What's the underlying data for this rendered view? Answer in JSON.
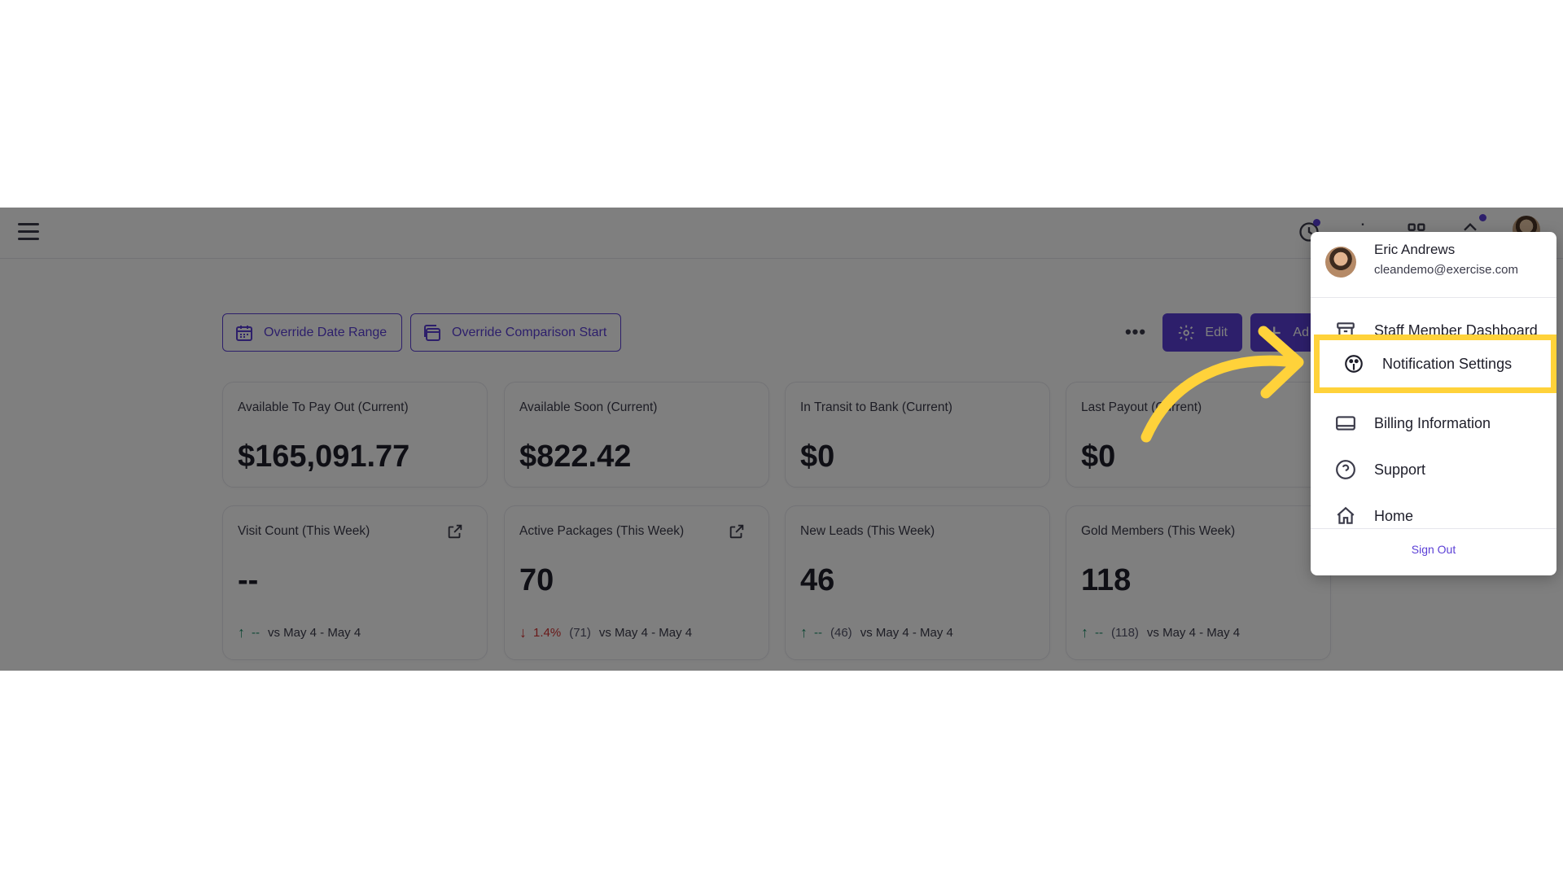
{
  "toolbar": {
    "override_date_range": "Override Date Range",
    "override_comparison_start": "Override Comparison Start",
    "more": "•••",
    "edit": "Edit",
    "add": "Ad"
  },
  "cards": [
    {
      "label": "Available To Pay Out (Current)",
      "value": "$165,091.77"
    },
    {
      "label": "Available Soon (Current)",
      "value": "$822.42"
    },
    {
      "label": "In Transit to Bank (Current)",
      "value": "$0"
    },
    {
      "label": "Last Payout (Current)",
      "value": "$0"
    },
    {
      "label": "Visit Count (This Week)",
      "value": "--",
      "trend": "up",
      "pct": "--",
      "prev": "",
      "range": "vs May 4 - May 4"
    },
    {
      "label": "Active Packages (This Week)",
      "value": "70",
      "trend": "down",
      "pct": "1.4%",
      "prev": "(71)",
      "range": "vs May 4 - May 4"
    },
    {
      "label": "New Leads (This Week)",
      "value": "46",
      "trend": "up",
      "pct": "--",
      "prev": "(46)",
      "range": "vs May 4 - May 4"
    },
    {
      "label": "Gold Members (This Week)",
      "value": "118",
      "trend": "up",
      "pct": "--",
      "prev": "(118)",
      "range": "vs May 4 - May 4"
    }
  ],
  "menu": {
    "user_name": "Eric Andrews",
    "user_email": "cleandemo@exercise.com",
    "items": [
      {
        "label": "Staff Member Dashboard",
        "icon": "archive-icon"
      },
      {
        "label": "Notification Settings",
        "icon": "palette-icon"
      },
      {
        "label": "Billing Information",
        "icon": "credit-card-icon"
      },
      {
        "label": "Support",
        "icon": "help-circle-icon"
      },
      {
        "label": "Home",
        "icon": "home-icon"
      }
    ],
    "sign_out": "Sign Out"
  },
  "colors": {
    "brand": "#5b3fd6",
    "highlight": "#ffd23a",
    "trend_up": "#1f8f6a",
    "trend_down": "#d33232"
  }
}
